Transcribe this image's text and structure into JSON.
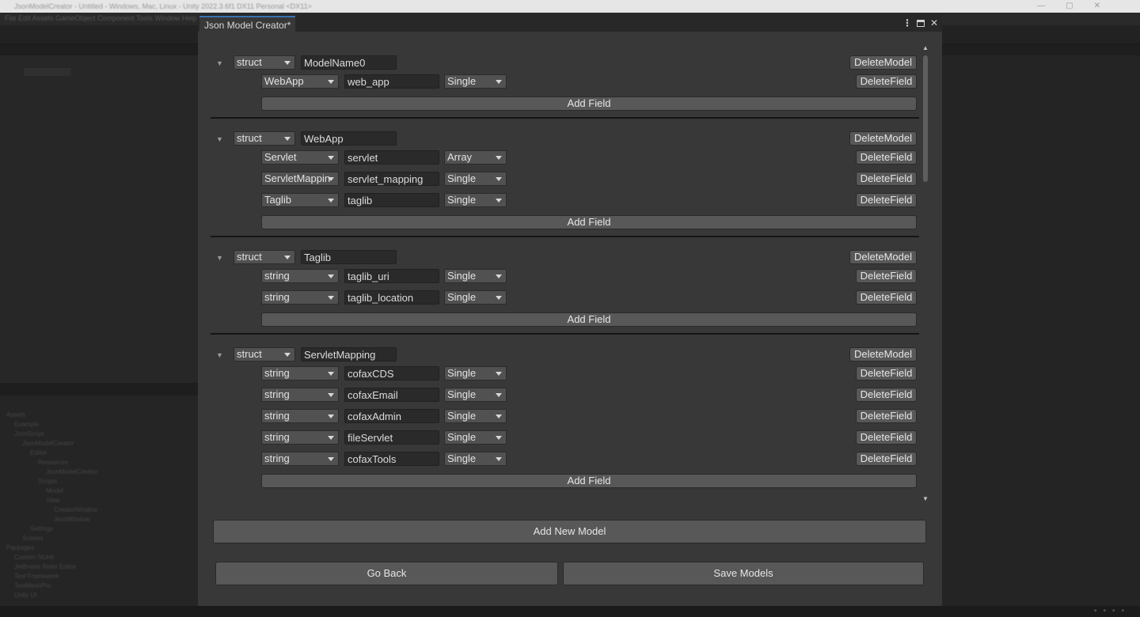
{
  "editor": {
    "title_text": "JsonModelCreator - Untitled - Windows, Mac, Linux - Unity 2022.3.6f1 DX11 Personal <DX11>",
    "menu_text": "File   Edit   Assets   GameObject   Component   Tools   Window   Help",
    "project_tree": [
      "Assets",
      "Example",
      "JsonScript",
      "JsonModelCreator",
      "Editor",
      "Resources",
      "JsonModelCreator",
      "Scripts",
      "Model",
      "View",
      "CreatorWindow",
      "JsonWindow",
      "Settings",
      "Scenes",
      "Packages",
      "Custom NUnit",
      "JetBrains Rider Editor",
      "Test Framework",
      "TextMeshPro",
      "Unity UI"
    ]
  },
  "window": {
    "tab_title": "Json Model Creator*",
    "menu_glyph": "⋮",
    "close_glyph": "✕"
  },
  "models": [
    {
      "kind": "struct",
      "name": "ModelName0",
      "delete_label": "DeleteModel",
      "add_field_label": "Add Field",
      "fields": [
        {
          "type": "WebApp",
          "name": "web_app",
          "multiplicity": "Single",
          "delete_label": "DeleteField"
        }
      ]
    },
    {
      "kind": "struct",
      "name": "WebApp",
      "delete_label": "DeleteModel",
      "add_field_label": "Add Field",
      "fields": [
        {
          "type": "Servlet",
          "name": "servlet",
          "multiplicity": "Array",
          "delete_label": "DeleteField"
        },
        {
          "type": "ServletMappin",
          "name": "servlet_mapping",
          "multiplicity": "Single",
          "delete_label": "DeleteField"
        },
        {
          "type": "Taglib",
          "name": "taglib",
          "multiplicity": "Single",
          "delete_label": "DeleteField"
        }
      ]
    },
    {
      "kind": "struct",
      "name": "Taglib",
      "delete_label": "DeleteModel",
      "add_field_label": "Add Field",
      "fields": [
        {
          "type": "string",
          "name": "taglib_uri",
          "multiplicity": "Single",
          "delete_label": "DeleteField"
        },
        {
          "type": "string",
          "name": "taglib_location",
          "multiplicity": "Single",
          "delete_label": "DeleteField"
        }
      ]
    },
    {
      "kind": "struct",
      "name": "ServletMapping",
      "delete_label": "DeleteModel",
      "add_field_label": "Add Field",
      "fields": [
        {
          "type": "string",
          "name": "cofaxCDS",
          "multiplicity": "Single",
          "delete_label": "DeleteField"
        },
        {
          "type": "string",
          "name": "cofaxEmail",
          "multiplicity": "Single",
          "delete_label": "DeleteField"
        },
        {
          "type": "string",
          "name": "cofaxAdmin",
          "multiplicity": "Single",
          "delete_label": "DeleteField"
        },
        {
          "type": "string",
          "name": "fileServlet",
          "multiplicity": "Single",
          "delete_label": "DeleteField"
        },
        {
          "type": "string",
          "name": "cofaxTools",
          "multiplicity": "Single",
          "delete_label": "DeleteField"
        }
      ]
    }
  ],
  "actions": {
    "add_new_model": "Add New Model",
    "go_back": "Go Back",
    "save_models": "Save Models"
  }
}
